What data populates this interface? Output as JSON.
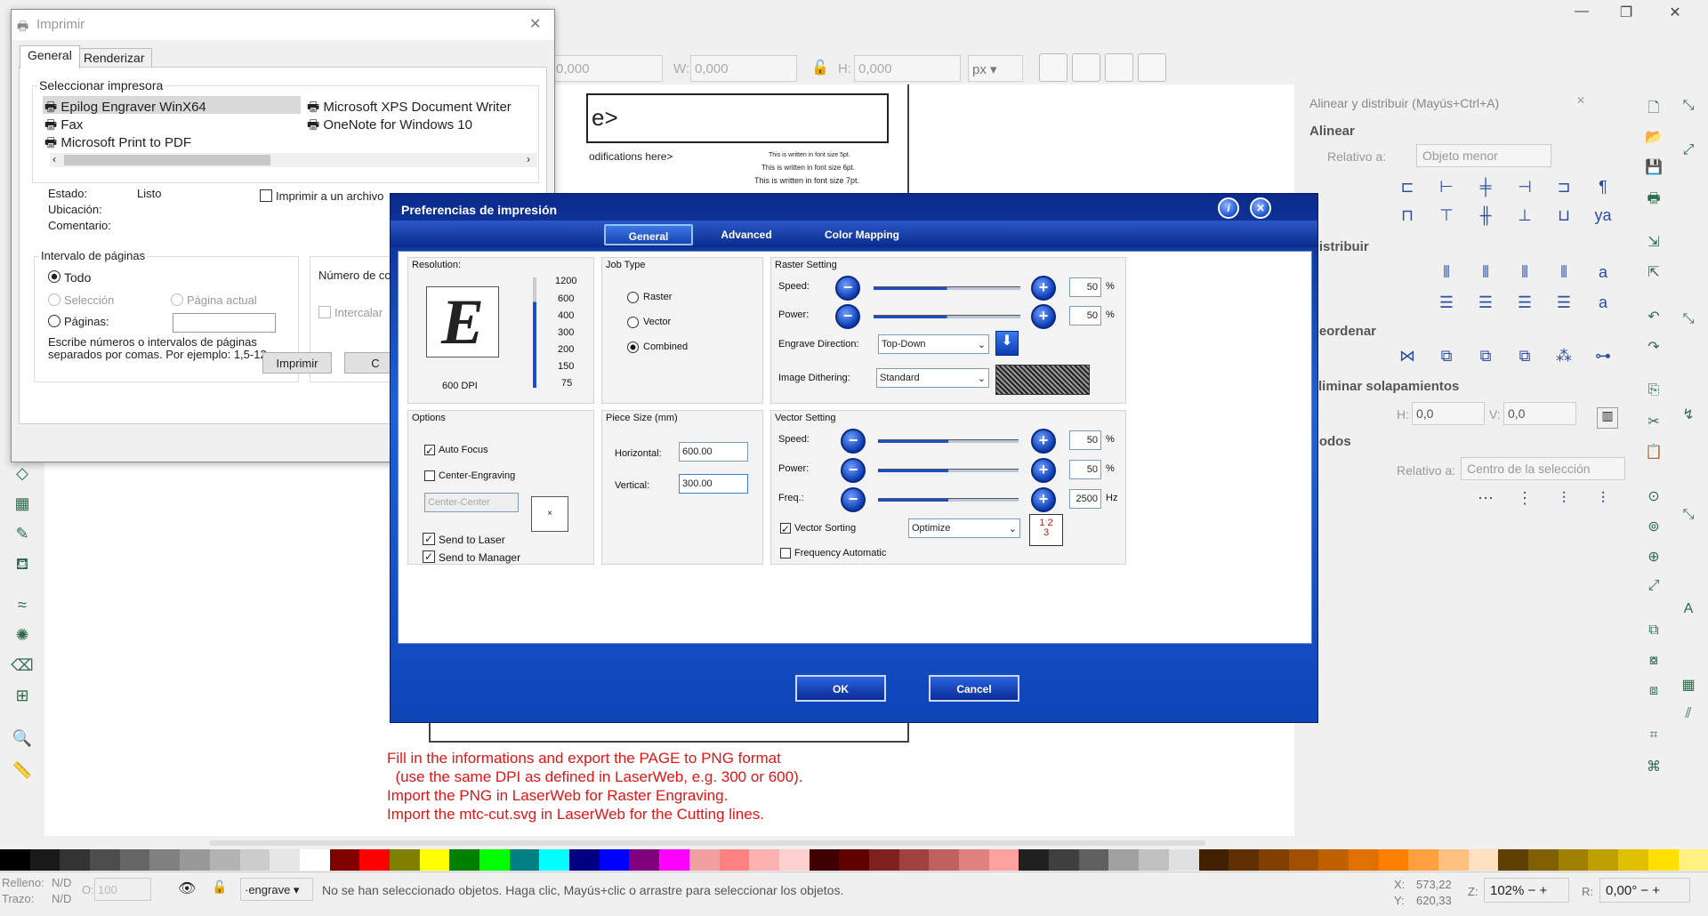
{
  "window": {
    "minimize": "—",
    "maximize": "❐",
    "close": "✕"
  },
  "toolbar": {
    "x_value": "0,000",
    "w_label": "W:",
    "w_value": "0,000",
    "h_label": "H:",
    "h_value": "0,000",
    "unit": "px"
  },
  "align_panel": {
    "title": "Alinear y distribuir (Mayús+Ctrl+A)",
    "section_align": "Alinear",
    "relative_label": "Relativo a:",
    "relative_value": "Objeto menor",
    "section_distribute": "Distribuir",
    "section_reorder": "Reordenar",
    "section_overlap": "Eliminar solapamientos",
    "h_label": "H:",
    "h_value": "0,0",
    "v_label": "V:",
    "v_value": "0,0",
    "section_nodes": "Nodos",
    "nodes_relative_label": "Relativo a:",
    "nodes_relative_value": "Centro de la selección"
  },
  "page_snippets": {
    "heading_fragment": "e>",
    "mod_fragment": "odifications here>",
    "line1": "This is written in font size 5pt.",
    "line2": "This is written in font size 6pt.",
    "line3": "This is written in font size 7pt."
  },
  "print_dialog": {
    "title": "Imprimir",
    "tab_general": "General",
    "tab_render": "Renderizar",
    "select_printer": "Seleccionar impresora",
    "printers": [
      "Epilog Engraver WinX64",
      "Fax",
      "Microsoft Print to PDF",
      "Microsoft XPS Document Writer",
      "OneNote for Windows 10"
    ],
    "estado_label": "Estado:",
    "estado_value": "Listo",
    "ubicacion_label": "Ubicación:",
    "comentario_label": "Comentario:",
    "print_to_file": "Imprimir a un archivo",
    "range_title": "Intervalo de páginas",
    "todo": "Todo",
    "seleccion": "Selección",
    "pagina_actual": "Página actual",
    "paginas": "Páginas:",
    "range_help": "Escribe números o intervalos de páginas separados por comas. Por ejemplo: 1,5-12",
    "copies_label": "Número de co",
    "intercalar": "Intercalar",
    "print_button": "Imprimir",
    "cancel_button": "C"
  },
  "pref_dialog": {
    "title": "Preferencias de impresión",
    "tabs": [
      "General",
      "Advanced",
      "Color Mapping"
    ],
    "resolution_label": "Resolution:",
    "dpi_values": [
      "1200",
      "600",
      "400",
      "300",
      "200",
      "150",
      "75"
    ],
    "dpi_selected": "600 DPI",
    "logo_letter": "E",
    "job_type_label": "Job Type",
    "job_raster": "Raster",
    "job_vector": "Vector",
    "job_combined": "Combined",
    "raster_label": "Raster Setting",
    "raster_speed_label": "Speed:",
    "raster_speed": "50",
    "raster_power_label": "Power:",
    "raster_power": "50",
    "percent": "%",
    "engrave_dir_label": "Engrave Direction:",
    "engrave_dir": "Top-Down",
    "dither_label": "Image Dithering:",
    "dither": "Standard",
    "options_label": "Options",
    "auto_focus": "Auto Focus",
    "center_engraving": "Center-Engraving",
    "center_value": "Center-Center",
    "send_laser": "Send to Laser",
    "send_manager": "Send to Manager",
    "piece_label": "Piece Size (mm)",
    "horizontal_label": "Horizontal:",
    "horizontal": "600.00",
    "vertical_label": "Vertical:",
    "vertical": "300.00",
    "vector_label": "Vector Setting",
    "v_speed_label": "Speed:",
    "v_speed": "50",
    "v_power_label": "Power:",
    "v_power": "50",
    "v_freq_label": "Freq.:",
    "v_freq": "2500",
    "hz": "Hz",
    "vector_sorting": "Vector Sorting",
    "sorting_value": "Optimize",
    "freq_auto": "Frequency Automatic",
    "ok": "OK",
    "cancel": "Cancel"
  },
  "instructions": [
    "Fill in the informations and export the PAGE to PNG format",
    "  (use the same DPI as defined in LaserWeb, e.g. 300 or 600).",
    "Import the PNG in LaserWeb for Raster Engraving.",
    "Import the mtc-cut.svg in LaserWeb for the Cutting lines."
  ],
  "status": {
    "fill_label": "Relleno:",
    "fill_value": "N/D",
    "stroke_label": "Trazo:",
    "stroke_value": "N/D",
    "opacity_label": "O:",
    "opacity_value": "100",
    "layer": "·engrave",
    "message": "No se han seleccionado objetos. Haga clic, Mayús+clic o arrastre para seleccionar los objetos.",
    "x_label": "X:",
    "x_value": "573,22",
    "y_label": "Y:",
    "y_value": "620,33",
    "z_label": "Z:",
    "zoom": "102%",
    "r_label": "R:",
    "rotation": "0,00°"
  },
  "palette_colors": [
    "#000000",
    "#1a1a1a",
    "#333333",
    "#4d4d4d",
    "#666666",
    "#808080",
    "#999999",
    "#b3b3b3",
    "#cccccc",
    "#e6e6e6",
    "#ffffff",
    "#800000",
    "#ff0000",
    "#808000",
    "#ffff00",
    "#008000",
    "#00ff00",
    "#008080",
    "#00ffff",
    "#000080",
    "#0000ff",
    "#800080",
    "#ff00ff",
    "#f0a0a0",
    "#ff8080",
    "#ffb0b0",
    "#ffd0d0",
    "#400000",
    "#600000",
    "#802020",
    "#a04040",
    "#c06060",
    "#e08080",
    "#ffa0a0",
    "#202020",
    "#404040",
    "#606060",
    "#a0a0a0",
    "#c0c0c0",
    "#e0e0e0",
    "#402000",
    "#603000",
    "#804000",
    "#a05000",
    "#c06000",
    "#e07000",
    "#ff8000",
    "#ffa040",
    "#ffc080",
    "#ffe0c0",
    "#604000",
    "#806000",
    "#a08000",
    "#c0a000",
    "#e0c000",
    "#ffe000",
    "#fff080"
  ]
}
